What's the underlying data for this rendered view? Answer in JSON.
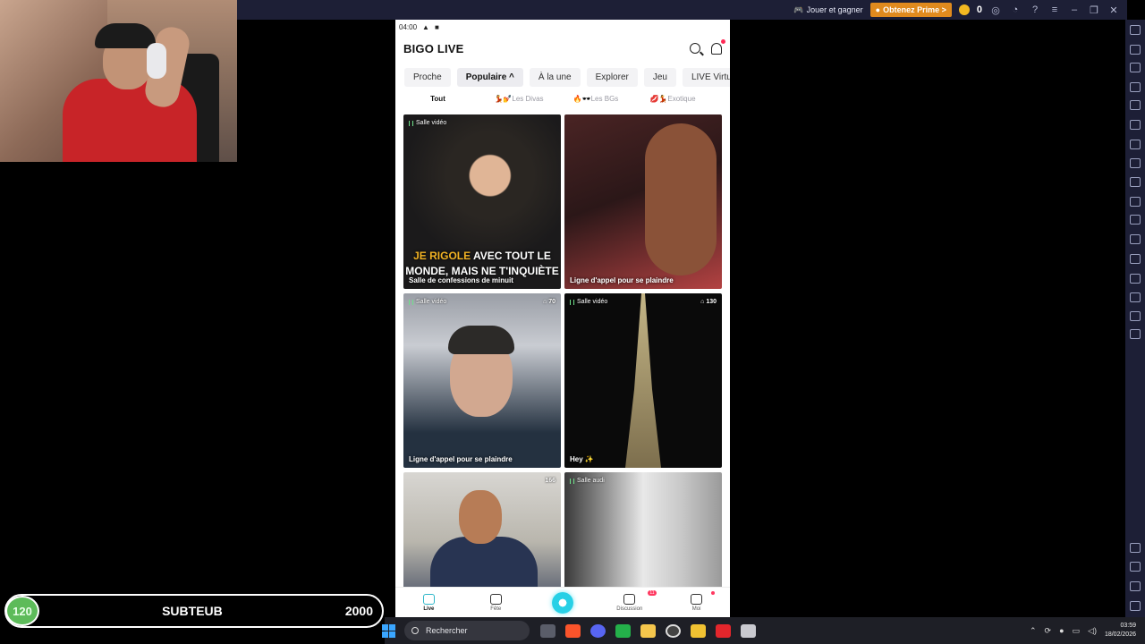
{
  "emulator": {
    "play_and_earn_label": "Jouer et gagner",
    "prime_label": "Obtenez Prime >",
    "coins": "0"
  },
  "phone": {
    "status_time": "04:00",
    "app_title": "BIGO LIVE",
    "tabs": [
      "Proche",
      "Populaire",
      "À la une",
      "Explorer",
      "Jeu",
      "LIVE Virtue"
    ],
    "active_tab_arrow": "^",
    "subtabs": [
      "Tout",
      "💃💅Les Divas",
      "🔥🕶️Les BGs",
      "💋💃Exotique"
    ],
    "cards": [
      {
        "type": "Salle vidéo",
        "viewers": "",
        "title": "Salle de confessions de minuit",
        "overlay_highlight": "JE RIGOLE",
        "overlay_text": " AVEC TOUT LE MONDE, MAIS NE T'INQUIÈTE"
      },
      {
        "type": "",
        "viewers": "",
        "title": "Ligne d'appel pour se plaindre"
      },
      {
        "type": "Salle vidéo",
        "viewers": "70",
        "title": "Ligne d'appel pour se plaindre"
      },
      {
        "type": "Salle vidéo",
        "viewers": "130",
        "title": "Hey ✨"
      },
      {
        "type": "",
        "viewers": "166",
        "title": ""
      },
      {
        "type": "Salle audi",
        "viewers": "",
        "title": ""
      }
    ],
    "nav": [
      {
        "label": "Live",
        "badge": ""
      },
      {
        "label": "Fête",
        "badge": ""
      },
      {
        "label": "",
        "badge": ""
      },
      {
        "label": "Discussion",
        "badge": "11"
      },
      {
        "label": "Moi",
        "badge": ""
      }
    ]
  },
  "goal": {
    "count": "120",
    "label": "SUBTEUB",
    "target": "2000"
  },
  "taskbar": {
    "search_placeholder": "Rechercher",
    "time": "03:59",
    "date": "18/02/2026"
  }
}
